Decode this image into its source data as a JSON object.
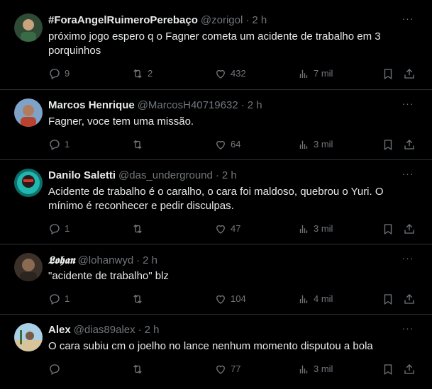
{
  "tweets": [
    {
      "name": "#ForaAngelRuimeroPerebaço",
      "handle": "@zorigol",
      "time": "2 h",
      "text": "próximo jogo espero q o Fagner cometa um acidente de trabalho em 3 porquinhos",
      "replies": "9",
      "retweets": "2",
      "likes": "432",
      "views": "7 mil",
      "avatar_color": "#3a5a40"
    },
    {
      "name": "Marcos Henrique",
      "handle": "@MarcosH40719632",
      "time": "2 h",
      "text": "Fagner, voce tem uma missão.",
      "replies": "1",
      "retweets": "",
      "likes": "64",
      "views": "3 mil",
      "avatar_color": "#6b8fb5"
    },
    {
      "name": "Danilo Saletti",
      "handle": "@das_underground",
      "time": "2 h",
      "text": "Acidente de trabalho é o caralho, o cara foi maldoso, quebrou o Yuri. O mínimo é reconhecer e pedir disculpas.",
      "replies": "1",
      "retweets": "",
      "likes": "47",
      "views": "3 mil",
      "avatar_color": "#1fa7a0"
    },
    {
      "name": "𝕷𝖔𝖍𝖆𝖓",
      "handle": "@lohanwyd",
      "time": "2 h",
      "text": "\"acidente de trabalho\" blz",
      "replies": "1",
      "retweets": "",
      "likes": "104",
      "views": "4 mil",
      "avatar_color": "#5a4a3a"
    },
    {
      "name": "Alex",
      "handle": "@dias89alex",
      "time": "2 h",
      "text": "O cara subiu cm o joelho no lance nenhum momento disputou a bola",
      "replies": "",
      "retweets": "",
      "likes": "77",
      "views": "3 mil",
      "avatar_color": "#9ec3d8"
    }
  ],
  "icons": {
    "reply": "reply-icon",
    "retweet": "retweet-icon",
    "like": "heart-icon",
    "views": "views-icon",
    "bookmark": "bookmark-icon",
    "share": "share-icon",
    "more": "more-icon"
  },
  "colors": {
    "background": "#000000",
    "text": "#e7e9ea",
    "muted": "#71767b",
    "divider": "#2f3336"
  }
}
